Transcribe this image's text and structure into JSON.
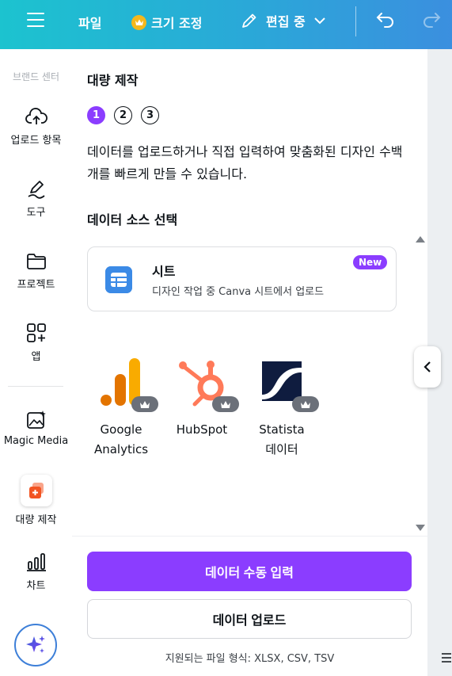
{
  "topbar": {
    "file_label": "파일",
    "resize_label": "크기 조정",
    "edit_label": "편집 중"
  },
  "rail": {
    "section_label": "브랜드 센터",
    "items": [
      {
        "label": "업로드 항목",
        "icon": "cloud-upload-icon"
      },
      {
        "label": "도구",
        "icon": "pen-tool-icon"
      },
      {
        "label": "프로젝트",
        "icon": "folder-icon"
      },
      {
        "label": "앱",
        "icon": "apps-grid-icon"
      },
      {
        "label": "Magic Media",
        "icon": "magic-media-icon"
      },
      {
        "label": "대량 제작",
        "icon": "bulk-create-icon"
      },
      {
        "label": "차트",
        "icon": "bar-chart-icon"
      }
    ]
  },
  "panel": {
    "title": "대량 제작",
    "steps": [
      "1",
      "2",
      "3"
    ],
    "description": "데이터를 업로드하거나 직접 입력하여 맞춤화된 디자인 수백 개를 빠르게 만들 수 있습니다.",
    "source_title": "데이터 소스 선택",
    "sheet": {
      "title": "시트",
      "description": "디자인 작업 중 Canva 시트에서 업로드",
      "badge": "New"
    },
    "integrations": [
      {
        "line1": "Google",
        "line2": "Analytics"
      },
      {
        "line1": "HubSpot",
        "line2": ""
      },
      {
        "line1": "Statista",
        "line2": "데이터"
      }
    ],
    "primary_button": "데이터 수동 입력",
    "secondary_button": "데이터 업로드",
    "formats": "지원되는 파일 형식: XLSX, CSV, TSV"
  },
  "colors": {
    "accent": "#8b3dff",
    "topbar_start": "#1cc3cf",
    "topbar_end": "#3b8fdf"
  }
}
